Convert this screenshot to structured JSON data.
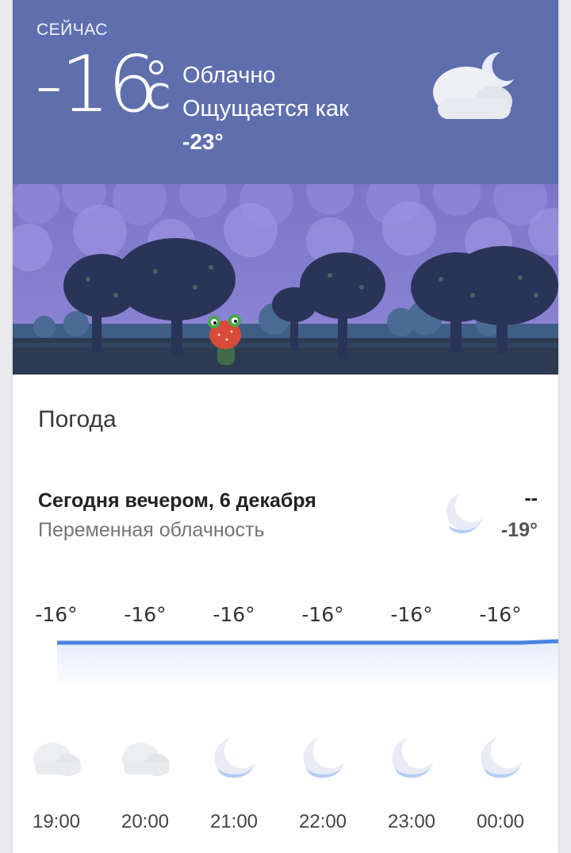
{
  "current": {
    "label": "СЕЙЧАС",
    "temp": "-16",
    "unit": "C",
    "condition": "Облачно",
    "feels_like_label": "Ощущается как",
    "feels_like_value": "-23°",
    "icon": "cloud-moon-icon"
  },
  "section": {
    "title": "Погода"
  },
  "tonight": {
    "title": "Сегодня вечером, 6 декабря",
    "subtitle": "Переменная облачность",
    "high": "--",
    "low": "-19°",
    "icon": "moon-cloud-icon"
  },
  "hourly": [
    {
      "temp": "-16°",
      "time": "19:00",
      "icon": "cloud-icon"
    },
    {
      "temp": "-16°",
      "time": "20:00",
      "icon": "cloud-icon"
    },
    {
      "temp": "-16°",
      "time": "21:00",
      "icon": "moon-cloud-icon"
    },
    {
      "temp": "-16°",
      "time": "22:00",
      "icon": "moon-cloud-icon"
    },
    {
      "temp": "-16°",
      "time": "23:00",
      "icon": "moon-cloud-icon"
    },
    {
      "temp": "-16°",
      "time": "00:00",
      "icon": "moon-cloud-icon"
    }
  ],
  "colors": {
    "header_bg": "#5f6fad",
    "trend_line": "#4a86e0",
    "scene_sky": "#8a7fd0"
  }
}
